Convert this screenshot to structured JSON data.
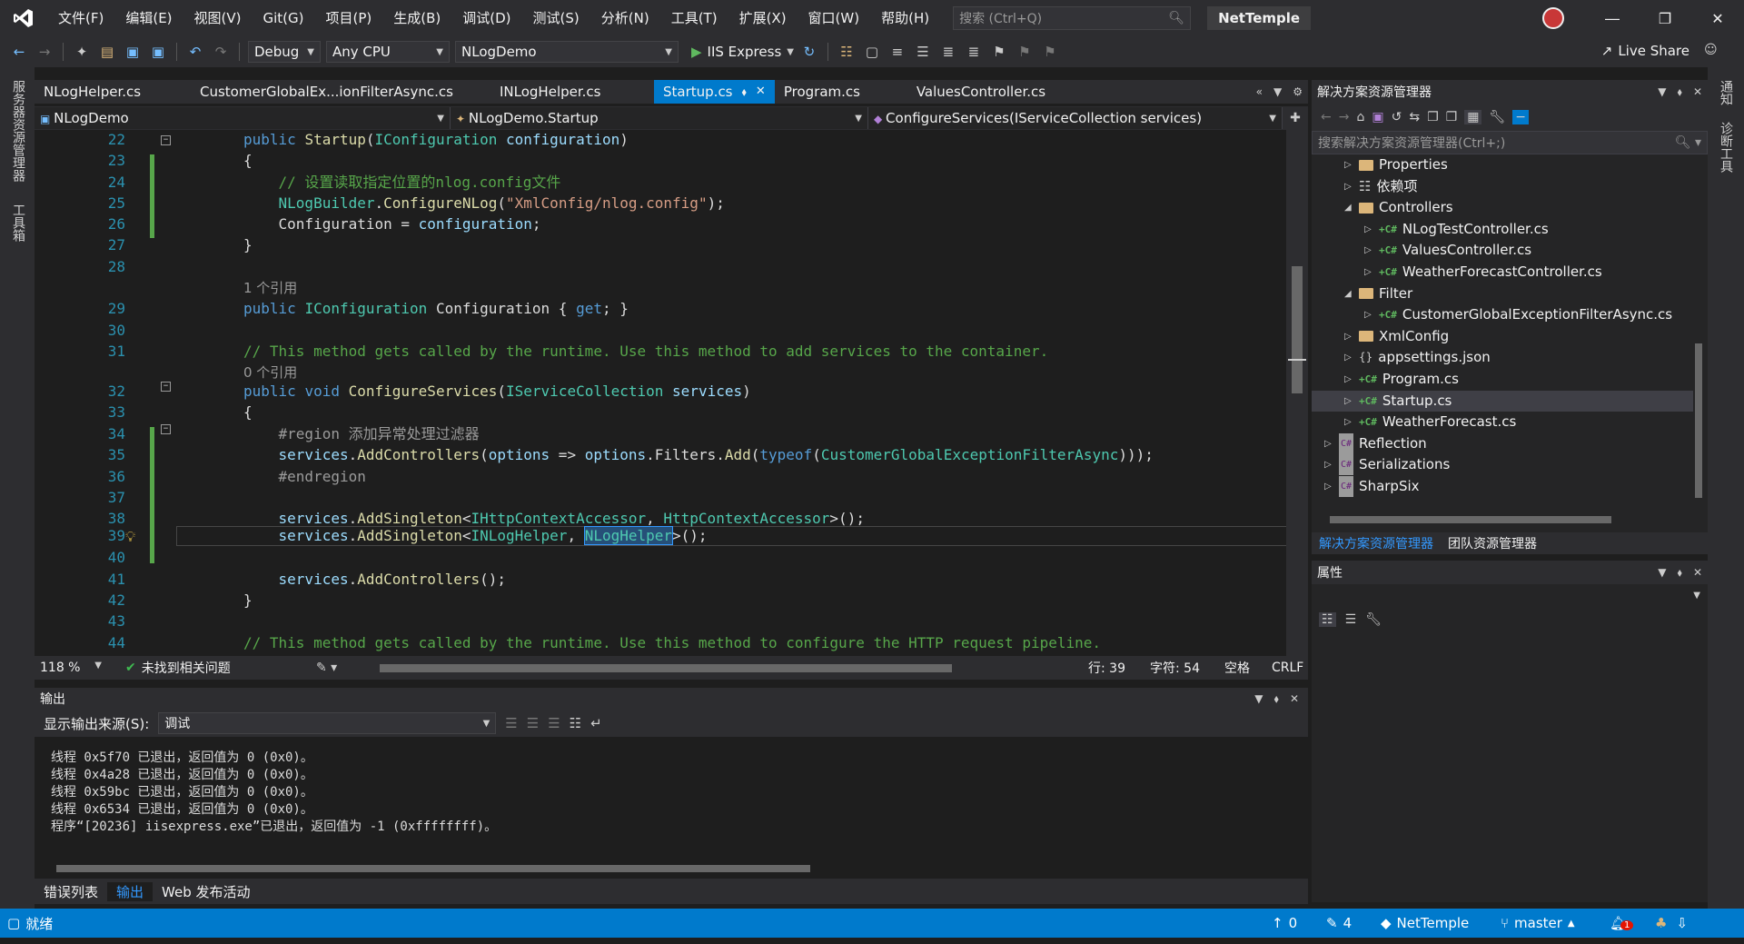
{
  "title_bar": {
    "menu": [
      "文件(F)",
      "编辑(E)",
      "视图(V)",
      "Git(G)",
      "项目(P)",
      "生成(B)",
      "调试(D)",
      "测试(S)",
      "分析(N)",
      "工具(T)",
      "扩展(X)",
      "窗口(W)",
      "帮助(H)"
    ],
    "search_placeholder": "搜索 (Ctrl+Q)",
    "solution_name": "NetTemple"
  },
  "toolbar": {
    "config": "Debug",
    "platform": "Any CPU",
    "startup_project": "NLogDemo",
    "run_label": "IIS Express",
    "live_share": "Live Share"
  },
  "left_strip": [
    "服务器资源管理器",
    "工具箱"
  ],
  "right_strip": [
    "通知",
    "诊断工具"
  ],
  "doc_tabs": [
    {
      "label": "NLogHelper.cs",
      "active": false
    },
    {
      "label": "CustomerGlobalEx...ionFilterAsync.cs",
      "active": false
    },
    {
      "label": "INLogHelper.cs",
      "active": false
    },
    {
      "label": "Startup.cs",
      "active": true
    },
    {
      "label": "Program.cs",
      "active": false
    },
    {
      "label": "ValuesController.cs",
      "active": false
    }
  ],
  "nav_bar": {
    "project": "NLogDemo",
    "type": "NLogDemo.Startup",
    "member": "ConfigureServices(IServiceCollection services)"
  },
  "code_lines": [
    {
      "n": "22",
      "text": "public Startup(IConfiguration configuration)"
    },
    {
      "n": "23",
      "text": "{"
    },
    {
      "n": "24",
      "text": "    // 设置读取指定位置的nlog.config文件"
    },
    {
      "n": "25",
      "text": "    NLogBuilder.ConfigureNLog(\"XmlConfig/nlog.config\");"
    },
    {
      "n": "26",
      "text": "    Configuration = configuration;"
    },
    {
      "n": "27",
      "text": "}"
    },
    {
      "n": "28",
      "text": ""
    },
    {
      "n": "",
      "text": "1 个引用"
    },
    {
      "n": "29",
      "text": "public IConfiguration Configuration { get; }"
    },
    {
      "n": "30",
      "text": ""
    },
    {
      "n": "31",
      "text": "// This method gets called by the runtime. Use this method to add services to the container."
    },
    {
      "n": "",
      "text": "0 个引用"
    },
    {
      "n": "32",
      "text": "public void ConfigureServices(IServiceCollection services)"
    },
    {
      "n": "33",
      "text": "{"
    },
    {
      "n": "34",
      "text": "    #region 添加异常处理过滤器"
    },
    {
      "n": "35",
      "text": "    services.AddControllers(options => options.Filters.Add(typeof(CustomerGlobalExceptionFilterAsync)));"
    },
    {
      "n": "36",
      "text": "    #endregion"
    },
    {
      "n": "37",
      "text": ""
    },
    {
      "n": "38",
      "text": "    services.AddSingleton<IHttpContextAccessor, HttpContextAccessor>();"
    },
    {
      "n": "39",
      "text": "    services.AddSingleton<INLogHelper, NLogHelper>();"
    },
    {
      "n": "40",
      "text": ""
    },
    {
      "n": "41",
      "text": "    services.AddControllers();"
    },
    {
      "n": "42",
      "text": "}"
    },
    {
      "n": "43",
      "text": ""
    },
    {
      "n": "44",
      "text": "// This method gets called by the runtime. Use this method to configure the HTTP request pipeline."
    }
  ],
  "editor_status": {
    "zoom": "118 %",
    "issues": "未找到相关问题",
    "line": "行: 39",
    "char": "字符: 54",
    "ws": "空格",
    "eol": "CRLF"
  },
  "output": {
    "title": "输出",
    "source_label": "显示输出来源(S):",
    "source_value": "调试",
    "lines": [
      "线程 0x5f70 已退出，返回值为 0 (0x0)。",
      "线程 0x4a28 已退出，返回值为 0 (0x0)。",
      "线程 0x59bc 已退出，返回值为 0 (0x0)。",
      "线程 0x6534 已退出，返回值为 0 (0x0)。",
      "程序“[20236] iisexpress.exe”已退出，返回值为 -1 (0xffffffff)。"
    ]
  },
  "bottom_tabs": [
    "错误列表",
    "输出",
    "Web 发布活动"
  ],
  "solution_explorer": {
    "title": "解决方案资源管理器",
    "search_placeholder": "搜索解决方案资源管理器(Ctrl+;)",
    "tree": [
      {
        "label": "Properties",
        "depth": 1,
        "icon": "folder",
        "expander": "collapsed"
      },
      {
        "label": "依赖项",
        "depth": 1,
        "icon": "deps",
        "expander": "collapsed"
      },
      {
        "label": "Controllers",
        "depth": 1,
        "icon": "folder",
        "expander": "expanded"
      },
      {
        "label": "NLogTestController.cs",
        "depth": 2,
        "icon": "cs",
        "expander": "collapsed"
      },
      {
        "label": "ValuesController.cs",
        "depth": 2,
        "icon": "cs",
        "expander": "collapsed"
      },
      {
        "label": "WeatherForecastController.cs",
        "depth": 2,
        "icon": "cs",
        "expander": "collapsed"
      },
      {
        "label": "Filter",
        "depth": 1,
        "icon": "folder",
        "expander": "expanded"
      },
      {
        "label": "CustomerGlobalExceptionFilterAsync.cs",
        "depth": 2,
        "icon": "cs",
        "expander": "collapsed"
      },
      {
        "label": "XmlConfig",
        "depth": 1,
        "icon": "folder",
        "expander": "collapsed"
      },
      {
        "label": "appsettings.json",
        "depth": 1,
        "icon": "json",
        "expander": "collapsed"
      },
      {
        "label": "Program.cs",
        "depth": 1,
        "icon": "cs",
        "expander": "collapsed"
      },
      {
        "label": "Startup.cs",
        "depth": 1,
        "icon": "cs",
        "expander": "collapsed",
        "selected": true
      },
      {
        "label": "WeatherForecast.cs",
        "depth": 1,
        "icon": "cs",
        "expander": "collapsed"
      },
      {
        "label": "Reflection",
        "depth": 0,
        "icon": "proj",
        "expander": "collapsed"
      },
      {
        "label": "Serializations",
        "depth": 0,
        "icon": "proj",
        "expander": "collapsed"
      },
      {
        "label": "SharpSix",
        "depth": 0,
        "icon": "proj",
        "expander": "collapsed"
      }
    ],
    "tabs": [
      "解决方案资源管理器",
      "团队资源管理器"
    ]
  },
  "properties": {
    "title": "属性"
  },
  "status_bar": {
    "ready": "就绪",
    "up_count": "0",
    "edit_count": "4",
    "repo": "NetTemple",
    "branch": "master",
    "notif_count": "1"
  },
  "colors": {
    "accent": "#007acc",
    "bg": "#1e1e1e",
    "chrome": "#2d2d30"
  }
}
